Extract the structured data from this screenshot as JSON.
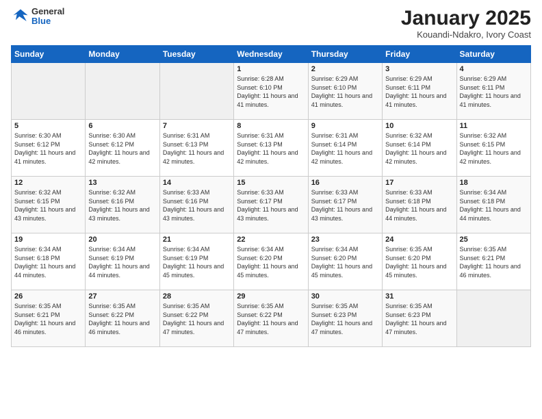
{
  "header": {
    "logo": {
      "general": "General",
      "blue": "Blue"
    },
    "title": "January 2025",
    "location": "Kouandi-Ndakro, Ivory Coast"
  },
  "days_of_week": [
    "Sunday",
    "Monday",
    "Tuesday",
    "Wednesday",
    "Thursday",
    "Friday",
    "Saturday"
  ],
  "weeks": [
    [
      {
        "num": "",
        "info": ""
      },
      {
        "num": "",
        "info": ""
      },
      {
        "num": "",
        "info": ""
      },
      {
        "num": "1",
        "info": "Sunrise: 6:28 AM\nSunset: 6:10 PM\nDaylight: 11 hours and 41 minutes."
      },
      {
        "num": "2",
        "info": "Sunrise: 6:29 AM\nSunset: 6:10 PM\nDaylight: 11 hours and 41 minutes."
      },
      {
        "num": "3",
        "info": "Sunrise: 6:29 AM\nSunset: 6:11 PM\nDaylight: 11 hours and 41 minutes."
      },
      {
        "num": "4",
        "info": "Sunrise: 6:29 AM\nSunset: 6:11 PM\nDaylight: 11 hours and 41 minutes."
      }
    ],
    [
      {
        "num": "5",
        "info": "Sunrise: 6:30 AM\nSunset: 6:12 PM\nDaylight: 11 hours and 41 minutes."
      },
      {
        "num": "6",
        "info": "Sunrise: 6:30 AM\nSunset: 6:12 PM\nDaylight: 11 hours and 42 minutes."
      },
      {
        "num": "7",
        "info": "Sunrise: 6:31 AM\nSunset: 6:13 PM\nDaylight: 11 hours and 42 minutes."
      },
      {
        "num": "8",
        "info": "Sunrise: 6:31 AM\nSunset: 6:13 PM\nDaylight: 11 hours and 42 minutes."
      },
      {
        "num": "9",
        "info": "Sunrise: 6:31 AM\nSunset: 6:14 PM\nDaylight: 11 hours and 42 minutes."
      },
      {
        "num": "10",
        "info": "Sunrise: 6:32 AM\nSunset: 6:14 PM\nDaylight: 11 hours and 42 minutes."
      },
      {
        "num": "11",
        "info": "Sunrise: 6:32 AM\nSunset: 6:15 PM\nDaylight: 11 hours and 42 minutes."
      }
    ],
    [
      {
        "num": "12",
        "info": "Sunrise: 6:32 AM\nSunset: 6:15 PM\nDaylight: 11 hours and 43 minutes."
      },
      {
        "num": "13",
        "info": "Sunrise: 6:32 AM\nSunset: 6:16 PM\nDaylight: 11 hours and 43 minutes."
      },
      {
        "num": "14",
        "info": "Sunrise: 6:33 AM\nSunset: 6:16 PM\nDaylight: 11 hours and 43 minutes."
      },
      {
        "num": "15",
        "info": "Sunrise: 6:33 AM\nSunset: 6:17 PM\nDaylight: 11 hours and 43 minutes."
      },
      {
        "num": "16",
        "info": "Sunrise: 6:33 AM\nSunset: 6:17 PM\nDaylight: 11 hours and 43 minutes."
      },
      {
        "num": "17",
        "info": "Sunrise: 6:33 AM\nSunset: 6:18 PM\nDaylight: 11 hours and 44 minutes."
      },
      {
        "num": "18",
        "info": "Sunrise: 6:34 AM\nSunset: 6:18 PM\nDaylight: 11 hours and 44 minutes."
      }
    ],
    [
      {
        "num": "19",
        "info": "Sunrise: 6:34 AM\nSunset: 6:18 PM\nDaylight: 11 hours and 44 minutes."
      },
      {
        "num": "20",
        "info": "Sunrise: 6:34 AM\nSunset: 6:19 PM\nDaylight: 11 hours and 44 minutes."
      },
      {
        "num": "21",
        "info": "Sunrise: 6:34 AM\nSunset: 6:19 PM\nDaylight: 11 hours and 45 minutes."
      },
      {
        "num": "22",
        "info": "Sunrise: 6:34 AM\nSunset: 6:20 PM\nDaylight: 11 hours and 45 minutes."
      },
      {
        "num": "23",
        "info": "Sunrise: 6:34 AM\nSunset: 6:20 PM\nDaylight: 11 hours and 45 minutes."
      },
      {
        "num": "24",
        "info": "Sunrise: 6:35 AM\nSunset: 6:20 PM\nDaylight: 11 hours and 45 minutes."
      },
      {
        "num": "25",
        "info": "Sunrise: 6:35 AM\nSunset: 6:21 PM\nDaylight: 11 hours and 46 minutes."
      }
    ],
    [
      {
        "num": "26",
        "info": "Sunrise: 6:35 AM\nSunset: 6:21 PM\nDaylight: 11 hours and 46 minutes."
      },
      {
        "num": "27",
        "info": "Sunrise: 6:35 AM\nSunset: 6:22 PM\nDaylight: 11 hours and 46 minutes."
      },
      {
        "num": "28",
        "info": "Sunrise: 6:35 AM\nSunset: 6:22 PM\nDaylight: 11 hours and 47 minutes."
      },
      {
        "num": "29",
        "info": "Sunrise: 6:35 AM\nSunset: 6:22 PM\nDaylight: 11 hours and 47 minutes."
      },
      {
        "num": "30",
        "info": "Sunrise: 6:35 AM\nSunset: 6:23 PM\nDaylight: 11 hours and 47 minutes."
      },
      {
        "num": "31",
        "info": "Sunrise: 6:35 AM\nSunset: 6:23 PM\nDaylight: 11 hours and 47 minutes."
      },
      {
        "num": "",
        "info": ""
      }
    ]
  ]
}
